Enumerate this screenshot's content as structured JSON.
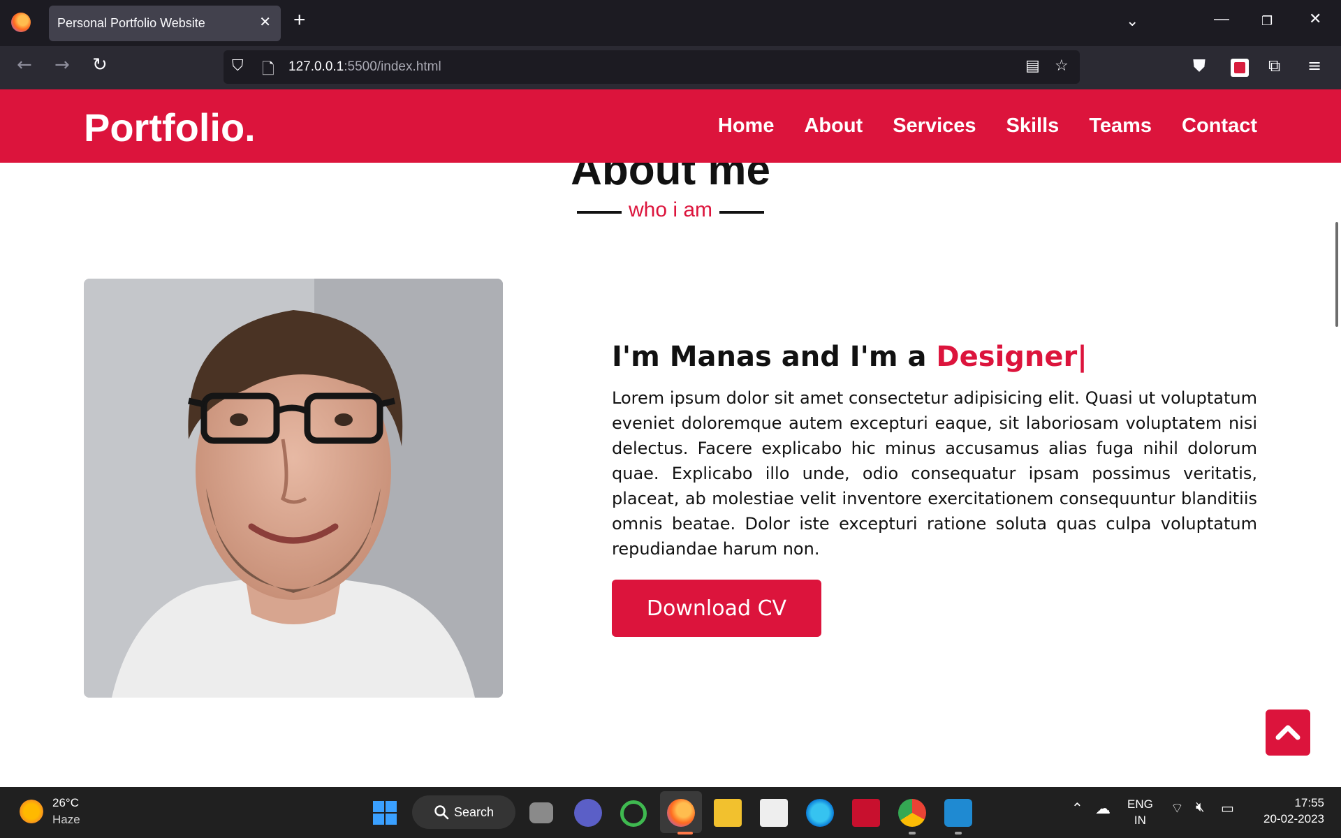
{
  "browser": {
    "tab_title": "Personal Portfolio Website",
    "url_host": "127.0.0.1",
    "url_rest": ":5500/index.html"
  },
  "site": {
    "logo": "Portfolio.",
    "nav": [
      "Home",
      "About",
      "Services",
      "Skills",
      "Teams",
      "Contact"
    ],
    "section_title": "About me",
    "section_subtitle": "who i am",
    "headline_prefix": "I'm Manas and I'm a ",
    "headline_role": "Designer|",
    "paragraph": "Lorem ipsum dolor sit amet consectetur adipisicing elit. Quasi ut voluptatum eveniet doloremque autem excepturi eaque, sit laboriosam voluptatem nisi delectus. Facere explicabo hic minus accusamus alias fuga nihil dolorum quae. Explicabo illo unde, odio consequatur ipsam possimus veritatis, placeat, ab molestiae velit inventore exercitationem consequuntur blanditiis omnis beatae. Dolor iste excepturi ratione soluta quas culpa voluptatum repudiandae harum non.",
    "cv_button": "Download CV",
    "accent": "#dc143c"
  },
  "taskbar": {
    "temperature": "26°C",
    "condition": "Haze",
    "search": "Search",
    "lang": "ENG",
    "region": "IN",
    "time": "17:55",
    "date": "20-02-2023"
  }
}
